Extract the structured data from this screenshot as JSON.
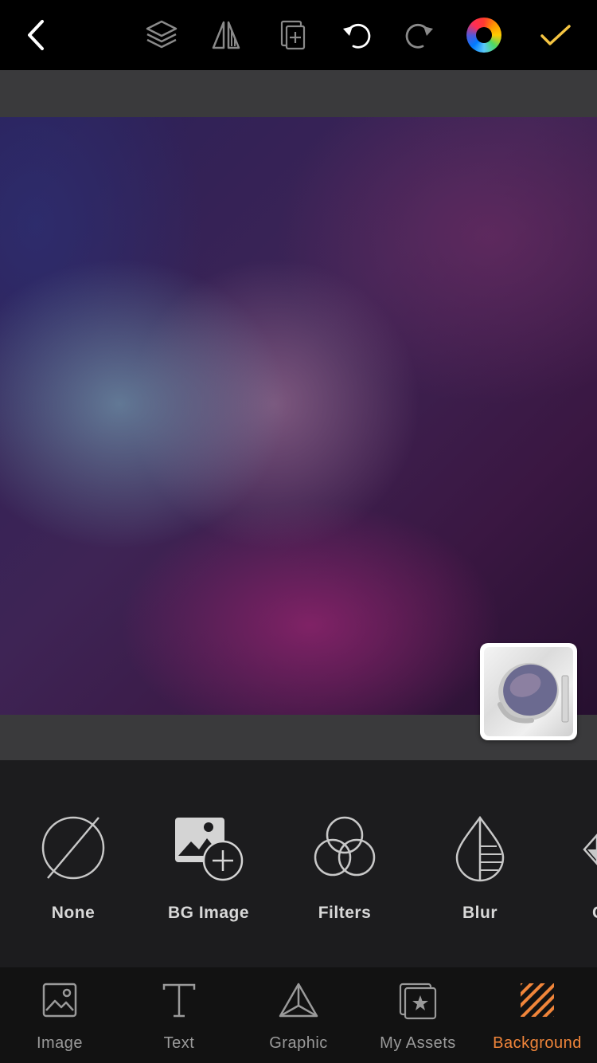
{
  "toolbar": {
    "icons": [
      "back-icon",
      "layers-icon",
      "flip-icon",
      "duplicate-icon",
      "undo-icon",
      "redo-icon",
      "color-wheel-icon",
      "checkmark-icon"
    ],
    "accent": "#f5c542"
  },
  "canvas": {
    "thumbnail_icon": "mirror-icon"
  },
  "background_options": [
    {
      "label": "None",
      "icon": "none-icon"
    },
    {
      "label": "BG Image",
      "icon": "add-image-icon"
    },
    {
      "label": "Filters",
      "icon": "filters-icon"
    },
    {
      "label": "Blur",
      "icon": "blur-icon"
    },
    {
      "label": "C",
      "icon": "partial-icon"
    }
  ],
  "tabs": [
    {
      "label": "Image",
      "icon": "image-icon",
      "active": false
    },
    {
      "label": "Text",
      "icon": "text-icon",
      "active": false
    },
    {
      "label": "Graphic",
      "icon": "graphic-icon",
      "active": false
    },
    {
      "label": "My Assets",
      "icon": "my-assets-icon",
      "active": false
    },
    {
      "label": "Background",
      "icon": "background-icon",
      "active": true
    }
  ],
  "colors": {
    "active_tab": "#f0853a",
    "confirm": "#f5c542"
  }
}
